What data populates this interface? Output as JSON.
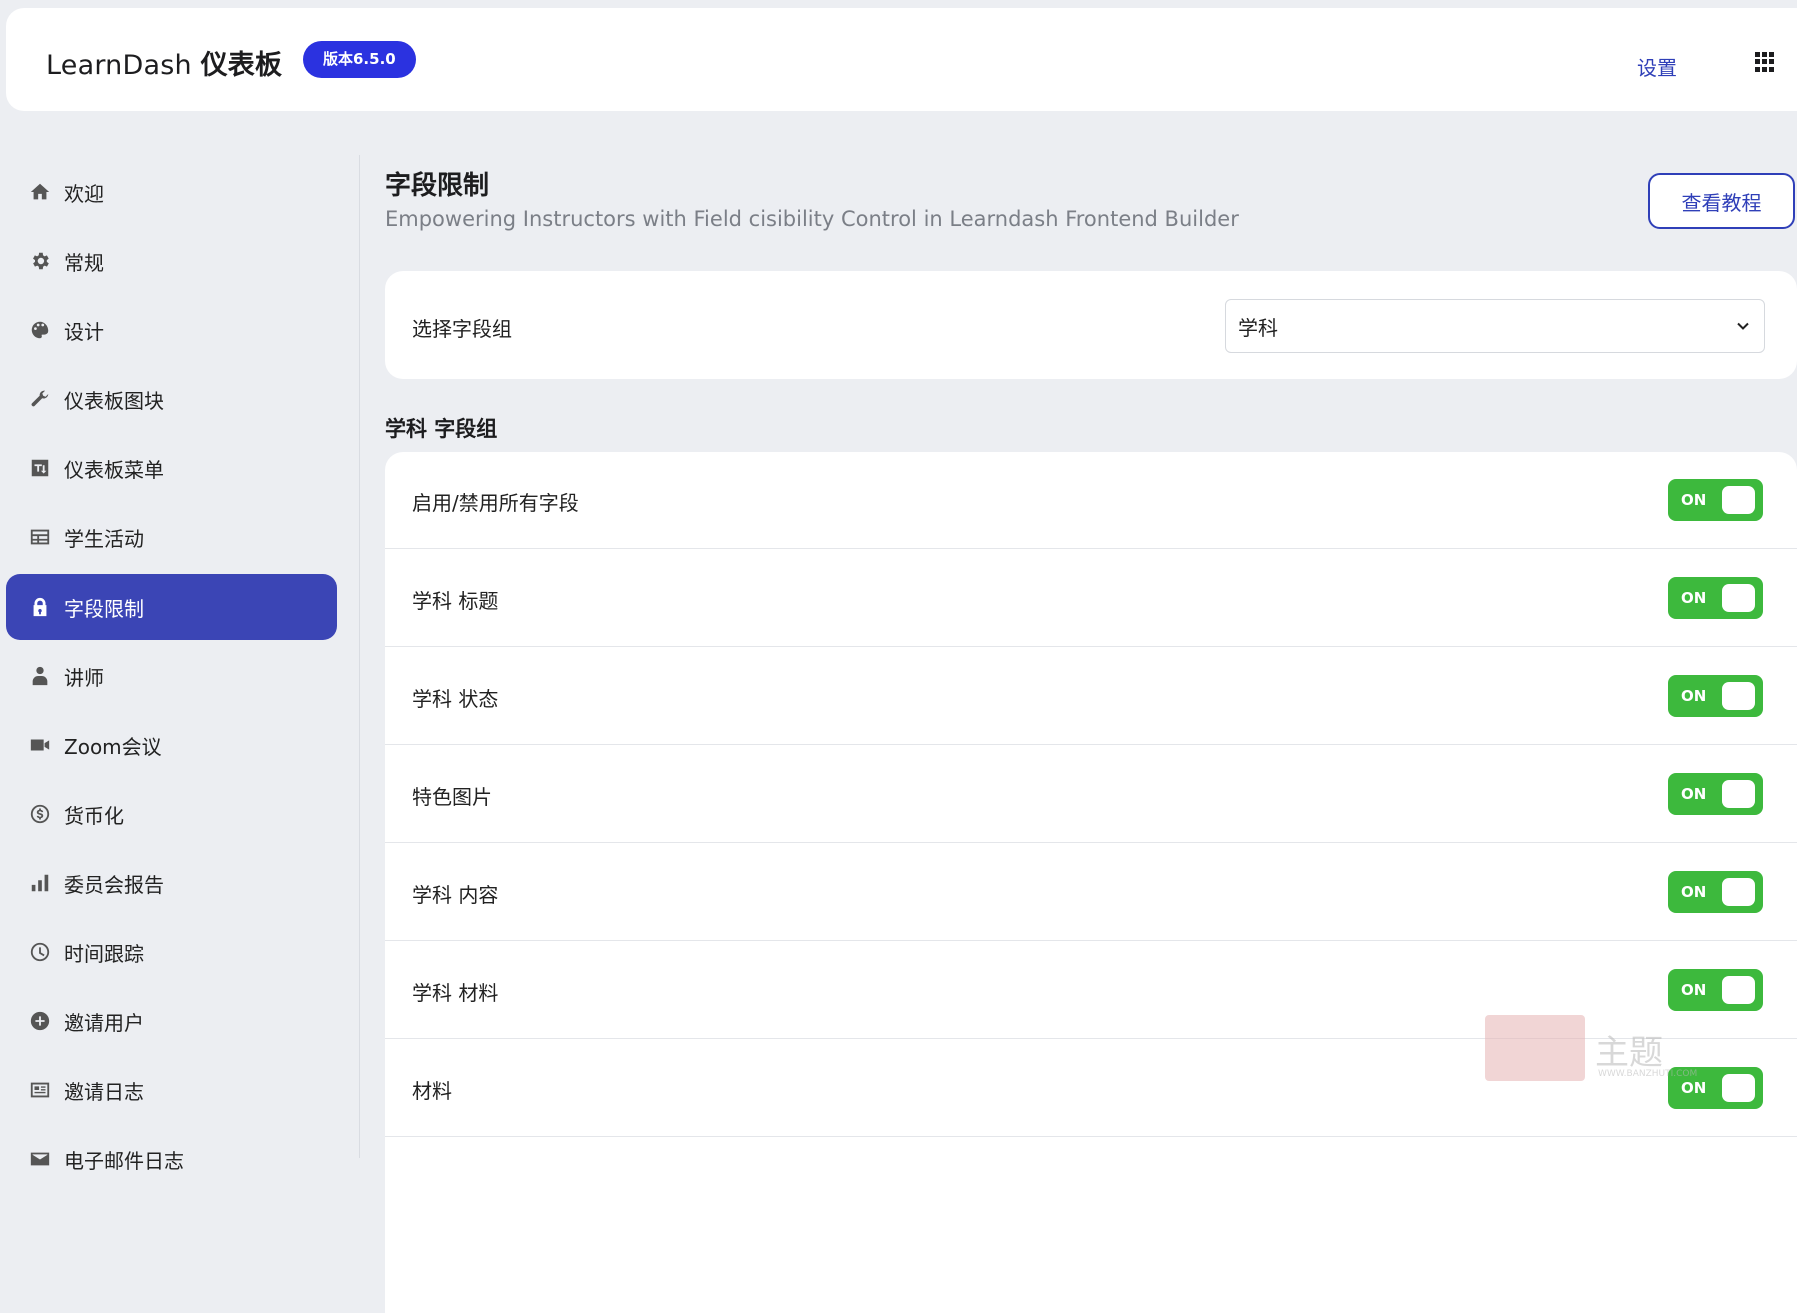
{
  "header": {
    "brand_name": "LearnDash",
    "brand_suffix": "仪表板",
    "version_badge": "版本6.5.0",
    "settings_link": "设置"
  },
  "sidebar": {
    "items": [
      {
        "label": "欢迎",
        "icon": "home-icon",
        "active": false
      },
      {
        "label": "常规",
        "icon": "gear-icon",
        "active": false
      },
      {
        "label": "设计",
        "icon": "palette-icon",
        "active": false
      },
      {
        "label": "仪表板图块",
        "icon": "wrench-icon",
        "active": false
      },
      {
        "label": "仪表板菜单",
        "icon": "sort-menu-icon",
        "active": false
      },
      {
        "label": "学生活动",
        "icon": "table-icon",
        "active": false
      },
      {
        "label": "字段限制",
        "icon": "lock-icon",
        "active": true
      },
      {
        "label": "讲师",
        "icon": "user-icon",
        "active": false
      },
      {
        "label": "Zoom会议",
        "icon": "video-camera-icon",
        "active": false
      },
      {
        "label": "货币化",
        "icon": "dollar-icon",
        "active": false
      },
      {
        "label": "委员会报告",
        "icon": "bar-chart-icon",
        "active": false
      },
      {
        "label": "时间跟踪",
        "icon": "clock-icon",
        "active": false
      },
      {
        "label": "邀请用户",
        "icon": "plus-circle-icon",
        "active": false
      },
      {
        "label": "邀请日志",
        "icon": "log-icon",
        "active": false
      },
      {
        "label": "电子邮件日志",
        "icon": "envelope-icon",
        "active": false
      }
    ],
    "active_color": "#3b45b5"
  },
  "main": {
    "title": "字段限制",
    "subtitle": "Empowering Instructors with Field cisibility Control in Learndash Frontend Builder",
    "tutorial_button": "查看教程",
    "select_label": "选择字段组",
    "select_value": "学科",
    "group_title": "学科 字段组",
    "fields": [
      {
        "label": "启用/禁用所有字段",
        "toggle": "ON"
      },
      {
        "label": "学科 标题",
        "toggle": "ON"
      },
      {
        "label": "学科 状态",
        "toggle": "ON"
      },
      {
        "label": "特色图片",
        "toggle": "ON"
      },
      {
        "label": "学科 内容",
        "toggle": "ON"
      },
      {
        "label": "学科 材料",
        "toggle": "ON"
      },
      {
        "label": "材料",
        "toggle": "ON"
      }
    ],
    "toggle_color": "#3db93d"
  },
  "watermark": {
    "text": "主题",
    "url": "WWW.BANZHUTI.COM"
  }
}
